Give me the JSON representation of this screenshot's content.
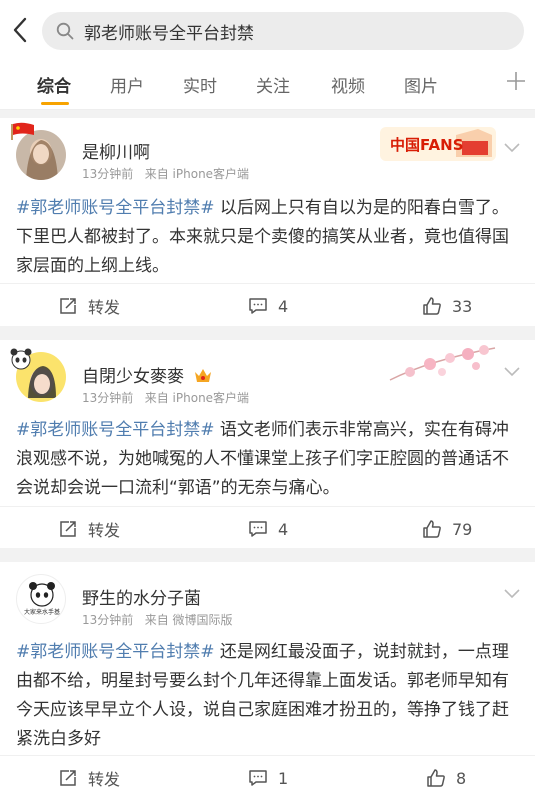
{
  "search": {
    "query": "郭老师账号全平台封禁"
  },
  "tabs": [
    {
      "label": "综合"
    },
    {
      "label": "用户"
    },
    {
      "label": "实时"
    },
    {
      "label": "关注"
    },
    {
      "label": "视频"
    },
    {
      "label": "图片"
    }
  ],
  "posts": [
    {
      "username": "是柳川啊",
      "time": "13分钟前",
      "source": "来自 iPhone客户端",
      "badge_text": "中国FANS",
      "hashtag": "#郭老师账号全平台封禁#",
      "text": " 以后网上只有自以为是的阳春白雪了。下里巴人都被封了。本来就只是个卖傻的搞笑从业者，竟也值得国家层面的上纲上线。",
      "repost_label": "转发",
      "comments": "4",
      "likes": "33"
    },
    {
      "username": "自閉少女麥麥",
      "time": "13分钟前",
      "source": "来自 iPhone客户端",
      "hashtag": "#郭老师账号全平台封禁#",
      "text": " 语文老师们表示非常高兴，实在有碍冲浪观感不说，为她喊冤的人不懂课堂上孩子们字正腔圆的普通话不会说却会说一口流利“郭语”的无奈与痛心。",
      "repost_label": "转发",
      "comments": "4",
      "likes": "79"
    },
    {
      "username": "野生的水分子菌",
      "time": "13分钟前",
      "source": "来自 微博国际版",
      "avatar_text": "大家来水手基",
      "hashtag": "#郭老师账号全平台封禁#",
      "text": " 还是网红最没面子，说封就封，一点理由都不给，明星封号要么封个几年还得靠上面发话。郭老师早知有今天应该早早立个人设，说自己家庭困难才扮丑的，等挣了钱了赶紧洗白多好",
      "repost_label": "转发",
      "comments": "1",
      "likes": "8"
    }
  ],
  "colors": {
    "accent": "#f7a300",
    "hashtag": "#507daf",
    "badge": "#d81e06"
  }
}
